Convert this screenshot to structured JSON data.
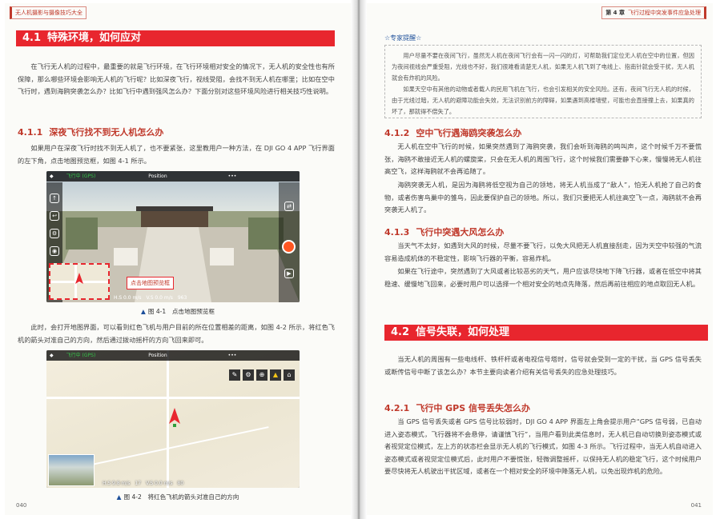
{
  "left_page": {
    "running_head": "无人机摄影与摄像技巧大全",
    "page_number": "040",
    "section": {
      "number": "4.1",
      "title": "特殊环境，如何应对"
    },
    "intro": "在飞行无人机的过程中，最重要的就是飞行环境，在飞行环境相对安全的情况下，无人机的安全性也有所保障，那么哪些环境会影响无人机的飞行呢？比如深夜飞行，视线受阻，会找不到无人机在哪里；比如在空中飞行时，遇到海鸥突袭怎么办？比如飞行中遇到强风怎么办？下面分别对这些环境风险进行相关技巧性说明。",
    "subsection": {
      "number": "4.1.1",
      "title": "深夜飞行找不到无人机怎么办"
    },
    "p1": "如果用户在深夜飞行时找不到无人机了，也不要紧张，这里教用户一种方法，在 DJI GO 4 APP 飞行界面的左下角，点击地图预览框，如图 4-1 所示。",
    "fig1": {
      "caption": "图 4-1　点击地图预览框",
      "mode_label": "飞行中 (GPS)",
      "position_label": "Position",
      "callout": "点击地图预览框",
      "telemetry": "H.S 0.0 m/s　V.S 0.0 m/s　963"
    },
    "p2": "此时，会打开地图界面，可以看到红色飞机与用户目前的所在位置相差的距离，如图 4-2 所示，将红色飞机的箭头对准自己的方向，然后通过拨动摇杆的方向飞回来即可。",
    "fig2": {
      "caption": "图 4-2　将红色飞机的箭头对准自己的方向",
      "mode_label": "飞行中 (GPS)",
      "position_label": "Position",
      "telemetry": "H.S 9.8 m/s　17　V.S 0.0 m/s　80"
    }
  },
  "right_page": {
    "running_head_chapter": "第 4 章",
    "running_head_title": "飞行过程中突发事件应急处理",
    "page_number": "041",
    "expert": {
      "title": "☆专家提醒☆",
      "p1": "用户尽量不要在夜间飞行，虽然无人机在夜间飞行会有一闪一闪的灯，可帮助我们定位无人机在空中的位置，但因为夜间视线会严重受阻，光线也不好，我们很难看清楚无人机，如果无人机飞到了电线上、指南针就会受干扰，无人机就会有炸机的风险。",
      "p2": "如果天空中有其他的动物或者载人的民用飞机在飞行，也会引发相关的安全风险。还有，夜间飞行无人机的时候，由于光线过暗，无人机的避障功能会失效，无法识别前方的障碍，如果遇到高楼墙壁，可能也会直接撞上去，如果真的坏了，那就得不偿失了。"
    },
    "sub412": {
      "number": "4.1.2",
      "title": "空中飞行遇海鸥突袭怎么办"
    },
    "p412a": "无人机在空中飞行的时候，如果突然遇到了海鸥突袭，我们会听到海鸥的鸣叫声，这个时候千万不要慌张，海鸥不敢接近无人机的螺旋桨，只会在无人机的周围飞行，这个时候我们需要静下心来，慢慢将无人机往高空飞，这样海鸥就不会再追随了。",
    "p412b": "海鸥突袭无人机，是因为海鸥将低空视为自己的领地，将无人机当成了“敌人”，怕无人机抢了自己的食物，或者伤害鸟巢中的雏鸟，因此要保护自己的领地。所以，我们只要把无人机往高空飞一点，海鸥就不会再突袭无人机了。",
    "sub413": {
      "number": "4.1.3",
      "title": "飞行中突遇大风怎么办"
    },
    "p413a": "当天气不太好，如遇到大风的时候，尽量不要飞行，以免大风把无人机直接刮走，因为天空中较强的气流容易造成机体的不稳定性，影响飞行器的平衡，容易炸机。",
    "p413b": "如果在飞行途中，突然遇到了大风或者比较恶劣的天气，用户应该尽快地下降飞行器，或者在低空中将其稳速、缓慢地飞回来，必要时用户可以选择一个相对安全的地点先降落，然后再前往相应的地点取回无人机。",
    "section42": {
      "number": "4.2",
      "title": "信号失联，如何处理"
    },
    "p42": "当无人机的周围有一些电线杆、铁杆杆或者电视信号塔时，信号就会受到一定的干扰，当 GPS 信号丢失或断传信号中断了该怎么办？本节主要向读者介绍有关信号丢失的应急处理技巧。",
    "sub421": {
      "number": "4.2.1",
      "title": "飞行中 GPS 信号丢失怎么办"
    },
    "p421": "当 GPS 信号丢失或者 GPS 信号比较弱时，DJI GO 4 APP 界面左上角会提示用户“GPS 信号弱，已自动进入姿态模式，飞行器将不会悬停，请谨慎飞行”，当用户看到此类信息时，无人机已自动切换到姿态模式或者视觉定位模式，左上方的状态栏会显示无人机的飞行模式，如图 4-3 所示。飞行过程中，当无人机自动进入姿态模式或者视觉定位模式后，此时用户不要慌张，轻微调整摇杆，以保持无人机的稳定飞行，这个时候用户要尽快将无人机驶出干扰区域，或者在一个相对安全的环境中降落无人机，以免出现炸机的危险。"
  },
  "colors": {
    "accent": "#e8262e",
    "heading": "#c0392b",
    "caption_marker": "#1d4f9a"
  },
  "icons": [
    "dji-logo-icon",
    "takeoff-icon",
    "return-home-icon",
    "camera-settings-icon",
    "shutter-button-icon",
    "playback-icon",
    "aircraft-arrow-icon"
  ]
}
